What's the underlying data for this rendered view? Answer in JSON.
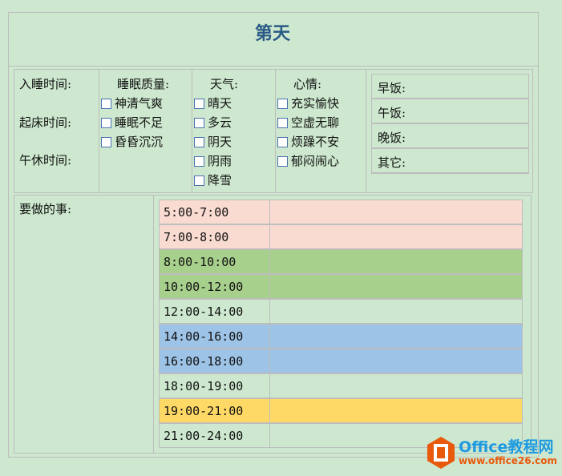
{
  "title": "第天",
  "sleep": {
    "bedtime": "入睡时间:",
    "waketime": "起床时间:",
    "nap": "午休时间:"
  },
  "quality": {
    "label": "睡眠质量:",
    "options": [
      "神清气爽",
      "睡眠不足",
      "昏昏沉沉"
    ]
  },
  "weather": {
    "label": "天气:",
    "options": [
      "晴天",
      "多云",
      "阴天",
      "阴雨",
      "降雪"
    ]
  },
  "mood": {
    "label": "心情:",
    "options": [
      "充实愉快",
      "空虚无聊",
      "烦躁不安",
      "郁闷闹心"
    ]
  },
  "meals": [
    "早饭:",
    "午饭:",
    "晚饭:",
    "其它:"
  ],
  "todo": {
    "label": "要做的事:",
    "slots": [
      "5:00-7:00",
      "7:00-8:00",
      "8:00-10:00",
      "10:00-12:00",
      "12:00-14:00",
      "14:00-16:00",
      "16:00-18:00",
      "18:00-19:00",
      "19:00-21:00",
      "21:00-24:00"
    ]
  },
  "colors": [
    "#f9dbd2",
    "#f9dbd2",
    "#a8d08d",
    "#a8d08d",
    "#cde8cf",
    "#9dc3e6",
    "#9dc3e6",
    "#cde8cf",
    "#ffd966",
    "#cde8cf"
  ],
  "watermark": {
    "brand": "Office教程网",
    "url": "www.office26.com"
  }
}
